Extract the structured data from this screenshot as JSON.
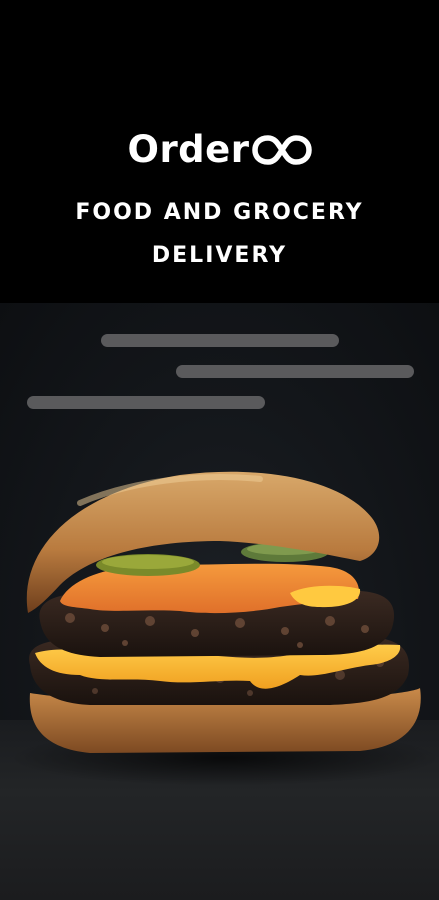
{
  "brand": {
    "name_text": "Order",
    "logo_symbol": "infinity-logo-icon"
  },
  "tagline": {
    "line1": "FOOD AND GROCERY",
    "line2": "DELIVERY"
  },
  "hero": {
    "image": "burger-photo",
    "loading_placeholders": 3
  },
  "colors": {
    "background": "#000000",
    "text": "#ffffff",
    "placeholder": "#5a5a5c"
  }
}
